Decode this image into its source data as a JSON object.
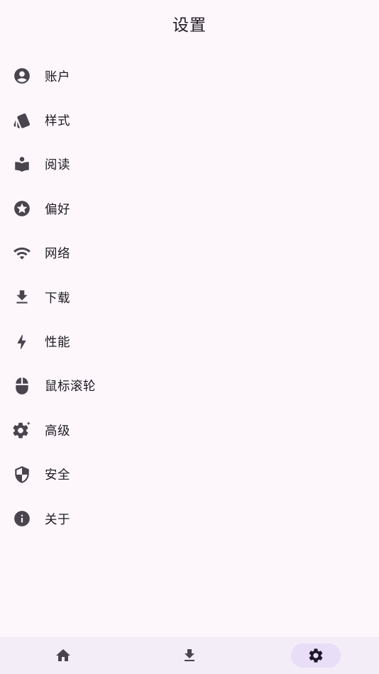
{
  "header": {
    "title": "设置"
  },
  "settings": {
    "items": [
      {
        "label": "账户",
        "icon": "account-circle-icon"
      },
      {
        "label": "样式",
        "icon": "style-cards-icon"
      },
      {
        "label": "阅读",
        "icon": "reader-book-icon"
      },
      {
        "label": "偏好",
        "icon": "star-circle-icon"
      },
      {
        "label": "网络",
        "icon": "wifi-icon"
      },
      {
        "label": "下载",
        "icon": "download-icon"
      },
      {
        "label": "性能",
        "icon": "bolt-icon"
      },
      {
        "label": "鼠标滚轮",
        "icon": "mouse-icon"
      },
      {
        "label": "高级",
        "icon": "settings-sparkle-icon"
      },
      {
        "label": "安全",
        "icon": "shield-icon"
      },
      {
        "label": "关于",
        "icon": "info-icon"
      }
    ]
  },
  "bottom_nav": {
    "items": [
      {
        "icon": "home-icon",
        "active": false
      },
      {
        "icon": "download-icon",
        "active": false
      },
      {
        "icon": "gear-icon",
        "active": true
      }
    ]
  },
  "colors": {
    "background": "#FDF7FC",
    "nav_background": "#F3EDF7",
    "active_indicator": "#E8DEF8",
    "icon": "#49454F",
    "text": "#1D1B20"
  }
}
